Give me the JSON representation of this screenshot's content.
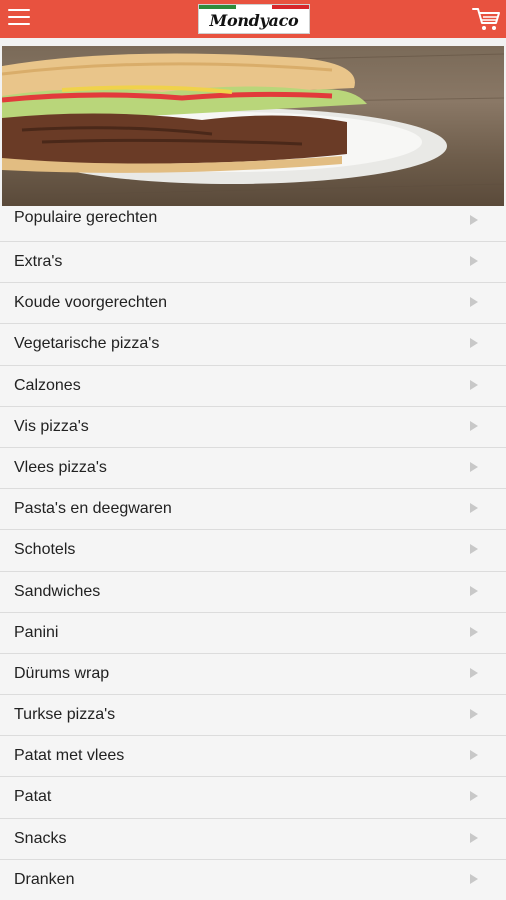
{
  "header": {
    "logo_text": "Mondyaco",
    "flag_colors": [
      "#2e8b3a",
      "#ffffff",
      "#d7262b"
    ],
    "accent": "#e8523f",
    "menu_icon": "hamburger-menu-icon",
    "cart_icon": "shopping-cart-icon"
  },
  "hero": {
    "image_subject": "doner sandwich on white plate"
  },
  "categories": [
    {
      "label": "Populaire gerechten"
    },
    {
      "label": "Extra's"
    },
    {
      "label": "Koude voorgerechten"
    },
    {
      "label": "Vegetarische pizza's"
    },
    {
      "label": "Calzones"
    },
    {
      "label": "Vis pizza's"
    },
    {
      "label": "Vlees pizza's"
    },
    {
      "label": "Pasta's en deegwaren"
    },
    {
      "label": "Schotels"
    },
    {
      "label": "Sandwiches"
    },
    {
      "label": "Panini"
    },
    {
      "label": "Dürums wrap"
    },
    {
      "label": "Turkse pizza's"
    },
    {
      "label": "Patat met vlees"
    },
    {
      "label": "Patat"
    },
    {
      "label": "Snacks"
    },
    {
      "label": "Dranken"
    }
  ]
}
